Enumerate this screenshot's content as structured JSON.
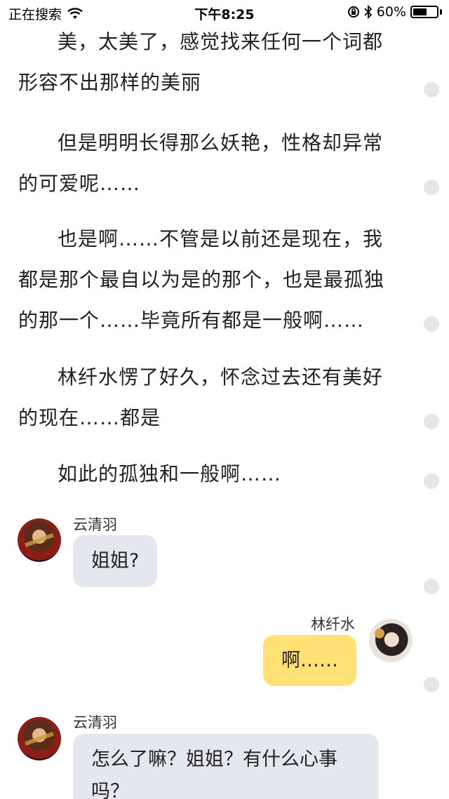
{
  "status_bar": {
    "carrier": "正在搜索",
    "time": "下午8:25",
    "battery_percent": "60%",
    "battery_level": 0.6
  },
  "paragraphs": [
    "美，太美了，感觉找来任何一个词都形容不出那样的美丽",
    "但是明明长得那么妖艳，性格却异常的可爱呢……",
    "也是啊……不管是以前还是现在，我都是那个最自以为是的那个，也是最孤独的那一个……毕竟所有都是一般啊……",
    "林纤水愣了好久，怀念过去还有美好的现在……都是",
    "如此的孤独和一般啊……"
  ],
  "chat": [
    {
      "sender": "云清羽",
      "text": "姐姐?"
    },
    {
      "sender": "林纤水",
      "text": "啊……"
    },
    {
      "sender": "云清羽",
      "text": "怎么了嘛？姐姐？有什么心事吗？"
    }
  ]
}
